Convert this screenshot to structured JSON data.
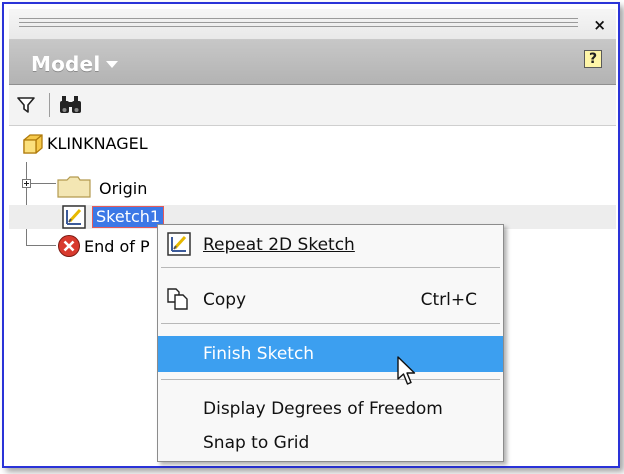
{
  "panel": {
    "close_label": "×",
    "model_title": "Model",
    "help_label": "?"
  },
  "toolbar": {
    "filter_icon": "filter-icon",
    "find_icon": "binoculars-icon"
  },
  "tree": {
    "root": "KLINKNAGEL",
    "items": [
      {
        "label": "Origin",
        "icon": "folder-icon"
      },
      {
        "label": "Sketch1",
        "icon": "sketch-icon",
        "selected": true
      },
      {
        "label": "End of P",
        "icon": "end-of-part-icon"
      }
    ]
  },
  "context_menu": {
    "items": [
      {
        "label": "Repeat 2D Sketch",
        "shortcut": ""
      },
      {
        "label": "Copy",
        "shortcut": "Ctrl+C"
      },
      {
        "label": "Finish Sketch",
        "shortcut": "",
        "highlighted": true
      },
      {
        "label": "Display Degrees of Freedom",
        "shortcut": ""
      },
      {
        "label": "Snap to Grid",
        "shortcut": ""
      }
    ]
  },
  "colors": {
    "window_border": "#2a33d8",
    "model_bar": "#c0c0c0",
    "selection_blue": "#3c78e6",
    "menu_highlight": "#3c9ff0"
  }
}
